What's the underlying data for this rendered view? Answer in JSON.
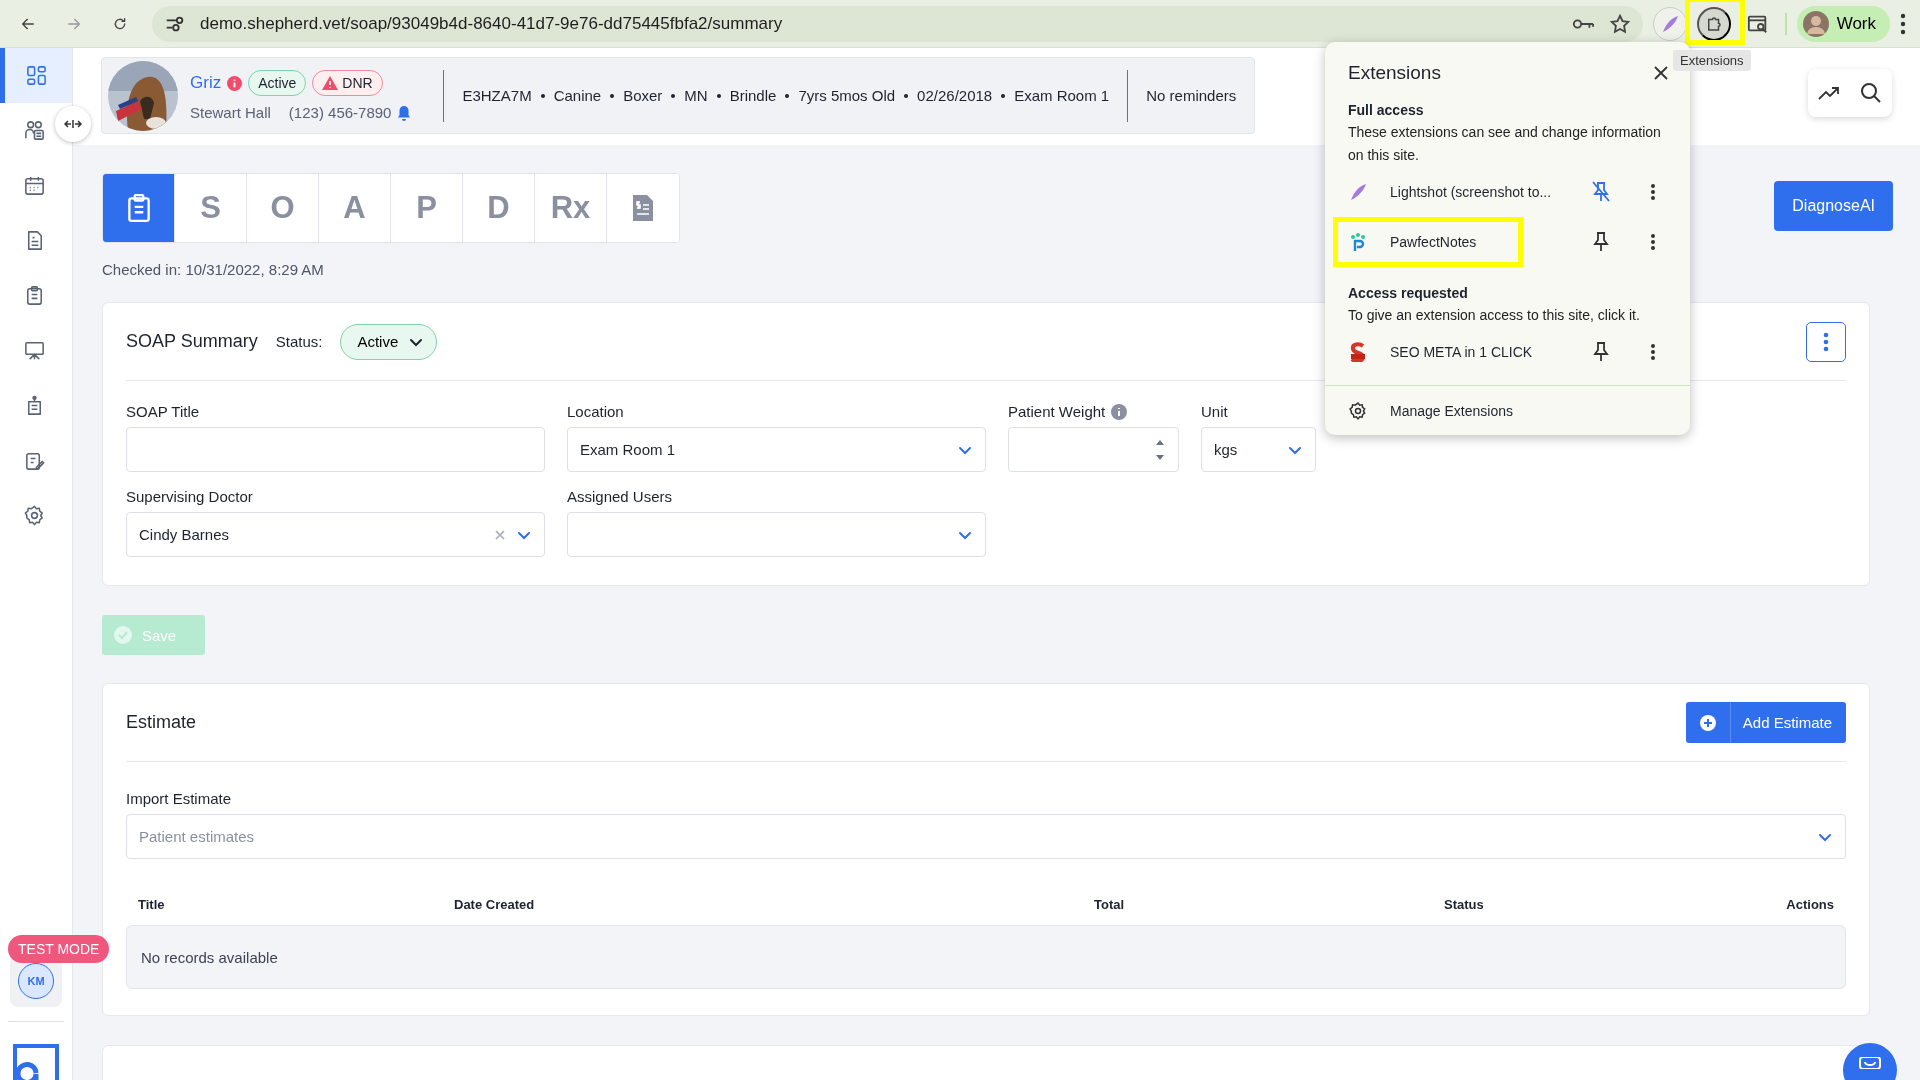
{
  "browser": {
    "url": "demo.shepherd.vet/soap/93049b4d-8640-41d7-9e76-dd75445fbfa2/summary",
    "tooltip": "Extensions",
    "profile": "Work",
    "extensions_highlighted": true
  },
  "sidebar": {
    "items": [
      {
        "kind": "dashboard",
        "selected": true
      },
      {
        "kind": "clients",
        "selected": false
      },
      {
        "kind": "calendar",
        "selected": false
      },
      {
        "kind": "invoice",
        "selected": false
      },
      {
        "kind": "clipboard",
        "selected": false
      },
      {
        "kind": "presentation",
        "selected": false
      },
      {
        "kind": "report",
        "selected": false
      },
      {
        "kind": "edit",
        "selected": false
      },
      {
        "kind": "settings",
        "selected": false
      }
    ],
    "test_mode": "TEST MODE",
    "user_initials": "KM"
  },
  "patient": {
    "name": "Griz",
    "badges": [
      {
        "label": "Active",
        "kind": "status"
      },
      {
        "label": "DNR",
        "kind": "alert"
      }
    ],
    "owner": "Stewart Hall",
    "phone": "(123) 456-7890",
    "details": [
      "E3HZA7M",
      "Canine",
      "Boxer",
      "MN",
      "Brindle",
      "7yrs 5mos Old",
      "02/26/2018",
      "Exam Room 1"
    ],
    "reminders": "No reminders"
  },
  "soap_tabs": [
    {
      "kind": "summary",
      "selected": true
    },
    {
      "kind": "letter",
      "label": "S",
      "selected": false
    },
    {
      "kind": "letter",
      "label": "O",
      "selected": false
    },
    {
      "kind": "letter",
      "label": "A",
      "selected": false
    },
    {
      "kind": "letter",
      "label": "P",
      "selected": false
    },
    {
      "kind": "letter",
      "label": "D",
      "selected": false
    },
    {
      "kind": "letter",
      "label": "Rx",
      "selected": false
    },
    {
      "kind": "invoice",
      "selected": false
    }
  ],
  "checked_in": "Checked in: 10/31/2022, 8:29 AM",
  "diagnose_button": "DiagnoseAI",
  "soap_summary": {
    "title": "SOAP Summary",
    "status_label": "Status:",
    "status": "Active",
    "fields": [
      {
        "label": "SOAP Title",
        "kind": "text",
        "info": false,
        "clearable": false
      },
      {
        "label": "Location",
        "kind": "select",
        "value": "Exam Room 1",
        "info": false,
        "clearable": false
      },
      {
        "label": "Patient Weight",
        "kind": "number",
        "info": true,
        "clearable": false
      },
      {
        "label": "Unit",
        "kind": "select",
        "value": "kgs",
        "info": false,
        "clearable": false
      },
      {
        "label": "Supervising Doctor",
        "kind": "select",
        "value": "Cindy Barnes",
        "info": false,
        "clearable": true
      },
      {
        "label": "Assigned Users",
        "kind": "select",
        "info": false,
        "clearable": false
      }
    ]
  },
  "save_button": {
    "label": "Save",
    "disabled": true
  },
  "estimate": {
    "title": "Estimate",
    "add_button": "Add Estimate",
    "import_label": "Import Estimate",
    "import_placeholder": "Patient estimates",
    "columns": [
      "Title",
      "Date Created",
      "Total",
      "Status",
      "Actions"
    ],
    "empty": "No records available"
  },
  "extensions_popup": {
    "title": "Extensions",
    "sections": [
      {
        "heading": "Full access",
        "description": "These extensions can see and change information on this site.",
        "items": [
          {
            "name": "Lightshot (screenshot to...",
            "kind": "feather",
            "pinned": true,
            "highlighted": false
          },
          {
            "name": "PawfectNotes",
            "kind": "paw",
            "pinned": false,
            "highlighted": true
          }
        ]
      },
      {
        "heading": "Access requested",
        "description": "To give an extension access to this site, click it.",
        "items": [
          {
            "name": "SEO META in 1 CLICK",
            "kind": "seo",
            "pinned": false,
            "highlighted": false
          }
        ]
      }
    ],
    "manage": "Manage Extensions"
  }
}
